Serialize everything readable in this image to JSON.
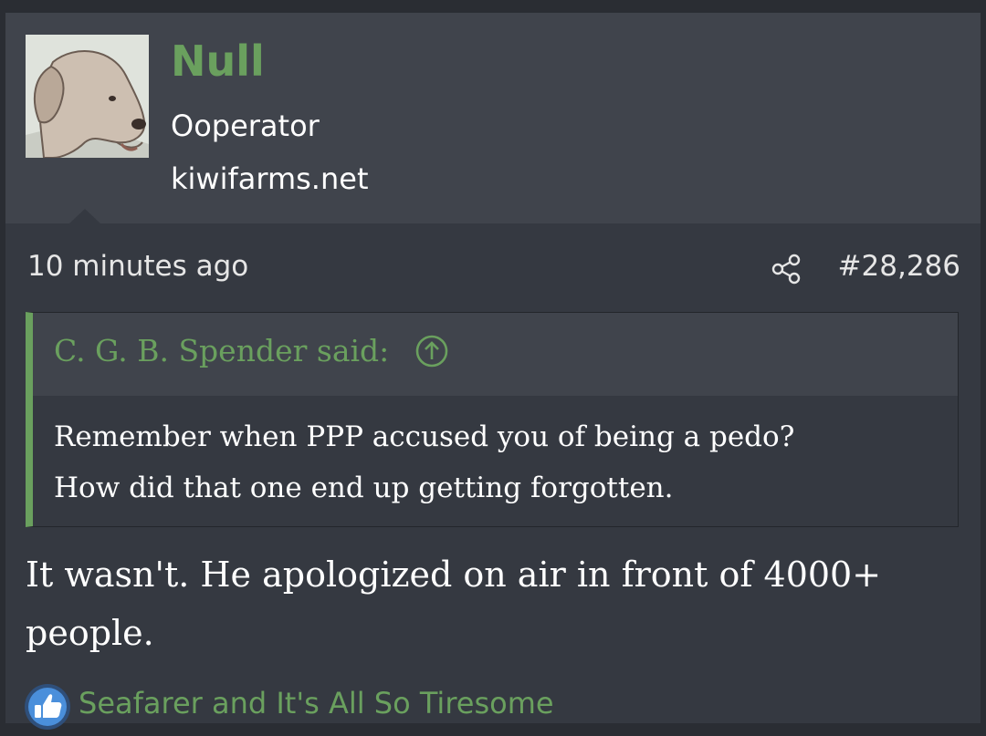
{
  "post": {
    "user": {
      "name": "Null",
      "title": "Ooperator",
      "site": "kiwifarms.net"
    },
    "meta": {
      "time": "10 minutes ago",
      "share_icon": "share-icon",
      "post_number": "#28,286"
    },
    "quote": {
      "author": "C. G. B. Spender said:",
      "jump_icon": "arrow-up-circle-icon",
      "lines": [
        "Remember when PPP accused you of being a pedo?",
        "How did that one end up getting forgotten."
      ]
    },
    "message": {
      "lines": [
        "It wasn't. He apologized on air in front of 4000+",
        "people."
      ]
    },
    "reactions": {
      "icon": "like-icon",
      "names": "Seafarer and It's All So Tiresome"
    }
  },
  "colors": {
    "accent": "#6aa05e",
    "text": "#ffffff",
    "panel": "#40444c",
    "body": "#353941",
    "page": "#2a2d33"
  }
}
